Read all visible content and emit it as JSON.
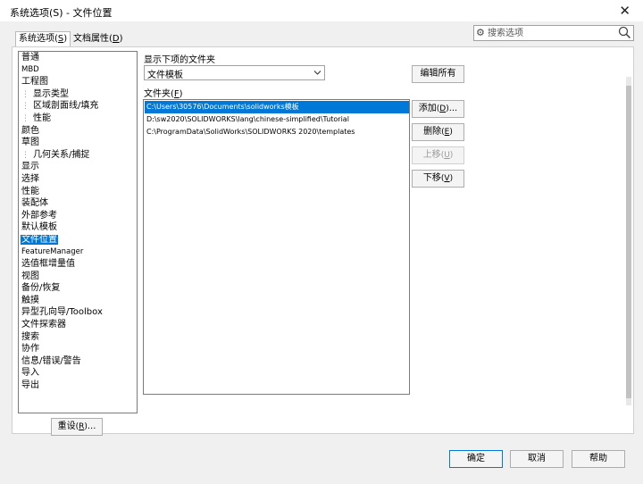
{
  "window": {
    "title": "系统选项(S) - 文件位置",
    "close_glyph": "✕"
  },
  "tabs": [
    {
      "label": "系统选项",
      "shortcut": "S"
    },
    {
      "label": "文档属性",
      "shortcut": "D"
    }
  ],
  "search": {
    "placeholder": "搜索选项"
  },
  "tree": [
    {
      "label": "普通"
    },
    {
      "label": "MBD",
      "small": true
    },
    {
      "label": "工程图"
    },
    {
      "label": "显示类型",
      "sub": true
    },
    {
      "label": "区域剖面线/填充",
      "sub": true
    },
    {
      "label": "性能",
      "sub": true
    },
    {
      "label": "颜色"
    },
    {
      "label": "草图"
    },
    {
      "label": "几何关系/捕捉",
      "sub": true
    },
    {
      "label": "显示"
    },
    {
      "label": "选择"
    },
    {
      "label": "性能"
    },
    {
      "label": "装配体"
    },
    {
      "label": "外部参考"
    },
    {
      "label": "默认模板"
    },
    {
      "label": "文件位置",
      "selected": true
    },
    {
      "label": "FeatureManager",
      "small": true
    },
    {
      "label": "选值框增量值"
    },
    {
      "label": "视图"
    },
    {
      "label": "备份/恢复"
    },
    {
      "label": "触摸"
    },
    {
      "label": "异型孔向导/Toolbox"
    },
    {
      "label": "文件探索器"
    },
    {
      "label": "搜索"
    },
    {
      "label": "协作"
    },
    {
      "label": "信息/错误/警告"
    },
    {
      "label": "导入"
    },
    {
      "label": "导出"
    }
  ],
  "show_folders_for": {
    "label": "显示下项的文件夹",
    "selected": "文件模板"
  },
  "folders": {
    "label": "文件夹",
    "shortcut": "F",
    "rows": [
      {
        "path": "C:\\Users\\30576\\Documents\\solidworks模板",
        "selected": true
      },
      {
        "path": "D:\\sw2020\\SOLIDWORKS\\lang\\chinese-simplified\\Tutorial"
      },
      {
        "path": "C:\\ProgramData\\SolidWorks\\SOLIDWORKS 2020\\templates"
      }
    ]
  },
  "buttons": {
    "edit_all": {
      "label": "编辑所有"
    },
    "add": {
      "label": "添加",
      "shortcut": "D",
      "suffix": "..."
    },
    "delete": {
      "label": "删除",
      "shortcut": "E"
    },
    "move_up": {
      "label": "上移",
      "shortcut": "U",
      "disabled": true
    },
    "move_down": {
      "label": "下移",
      "shortcut": "V"
    },
    "reset": {
      "label": "重设",
      "shortcut": "R",
      "suffix": "..."
    },
    "ok": {
      "label": "确定"
    },
    "cancel": {
      "label": "取消"
    },
    "help": {
      "label": "帮助"
    }
  },
  "colors": {
    "accent": "#0078d7"
  }
}
